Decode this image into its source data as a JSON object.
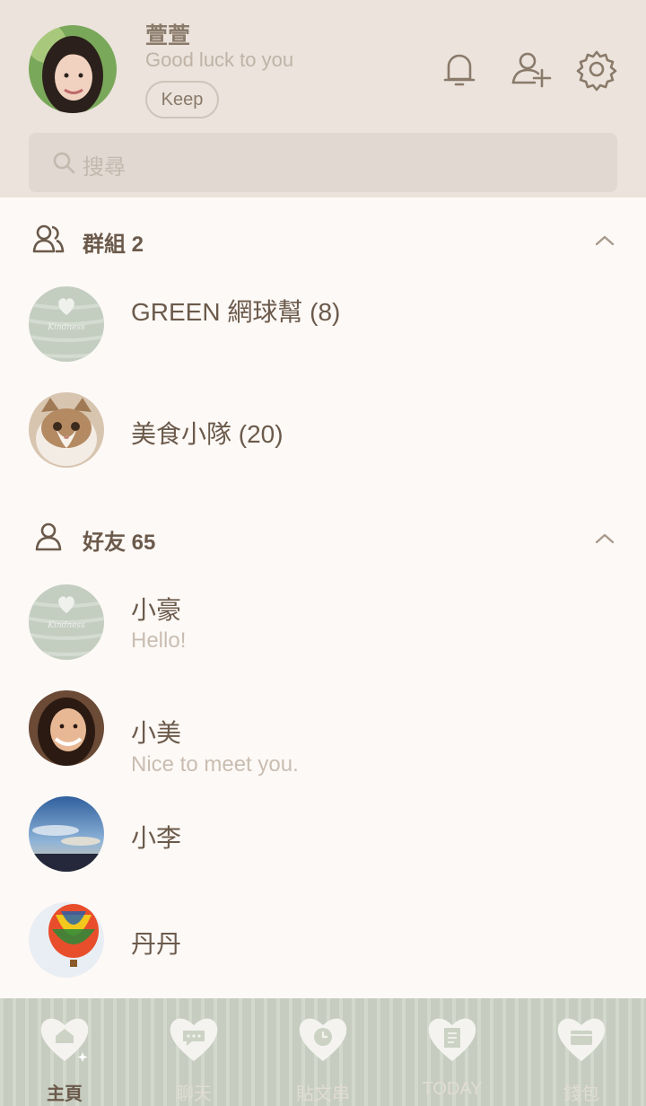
{
  "profile": {
    "name": "萱萱",
    "status": "Good luck to you",
    "keep_label": "Keep"
  },
  "header_icons": [
    "bell-icon",
    "add-friend-icon",
    "gear-icon"
  ],
  "search": {
    "placeholder": "搜尋"
  },
  "groups": {
    "title": "群組 2",
    "items": [
      {
        "name": "GREEN 網球幫 (8)",
        "avatar": "kindness-heart"
      },
      {
        "name": "美食小隊 (20)",
        "avatar": "cat-photo"
      }
    ]
  },
  "friends": {
    "title": "好友 65",
    "items": [
      {
        "name": "小豪",
        "status": "Hello!",
        "avatar": "kindness-heart"
      },
      {
        "name": "小美",
        "status": "Nice to meet you.",
        "avatar": "woman-photo"
      },
      {
        "name": "小李",
        "status": "",
        "avatar": "sky-photo"
      },
      {
        "name": "丹丹",
        "status": "",
        "avatar": "balloon-photo"
      }
    ]
  },
  "tabs": [
    {
      "label": "主頁",
      "icon": "home-icon",
      "active": true
    },
    {
      "label": "聊天",
      "icon": "chat-icon",
      "active": false
    },
    {
      "label": "貼文串",
      "icon": "timeline-icon",
      "active": false
    },
    {
      "label": "TODAY",
      "icon": "news-icon",
      "active": false
    },
    {
      "label": "錢包",
      "icon": "wallet-icon",
      "active": false
    }
  ],
  "colors": {
    "header_bg": "#ebe3dc",
    "list_bg": "#fdf9f6",
    "text_brown": "#6b5a4b",
    "tabbar_bg": "#ccd3c5"
  }
}
